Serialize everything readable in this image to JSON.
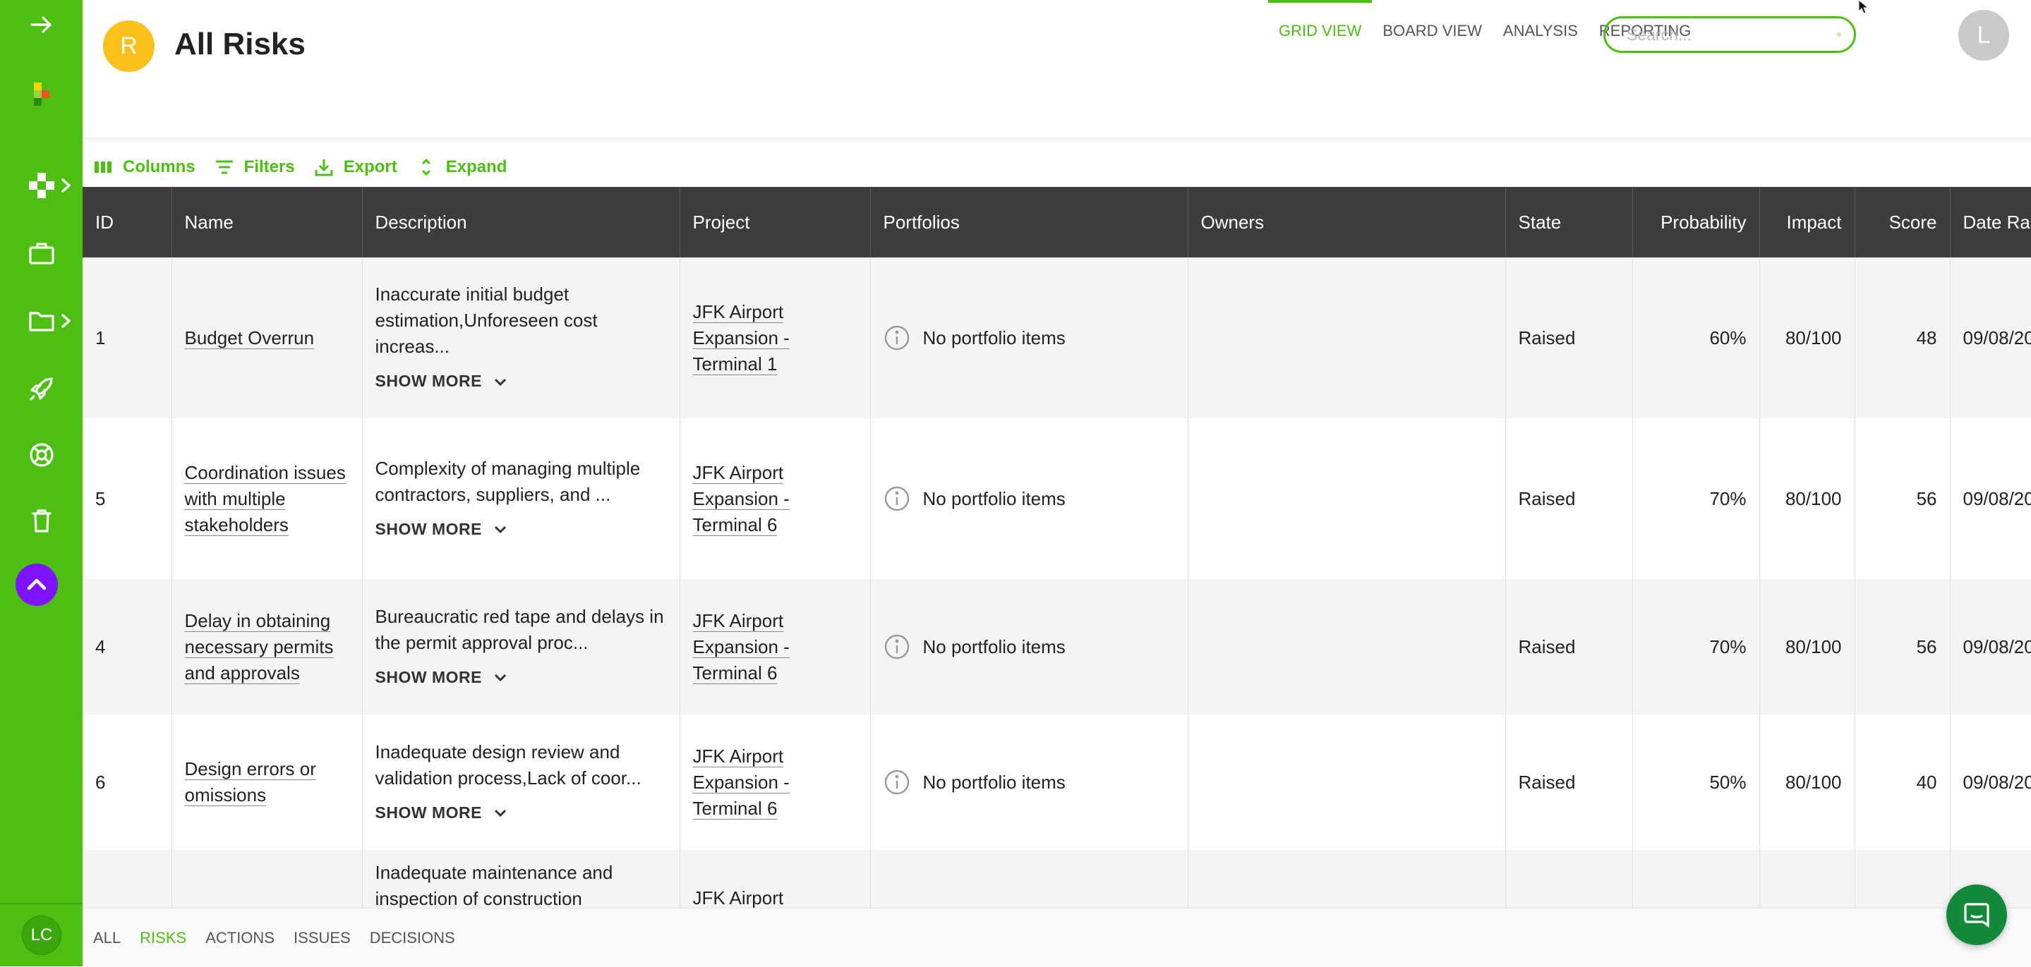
{
  "sidebar": {
    "user_initials": "LC",
    "icons": [
      "arrow-right-icon",
      "app-logo",
      "risk-hub-icon",
      "briefcase-icon",
      "folder-icon",
      "rocket-icon",
      "lifebuoy-icon",
      "trash-icon",
      "chevron-up-icon"
    ]
  },
  "header": {
    "project_initial": "R",
    "title": "All Risks",
    "tabs": [
      {
        "label": "GRID VIEW",
        "active": true
      },
      {
        "label": "BOARD VIEW",
        "active": false
      },
      {
        "label": "ANALYSIS",
        "active": false
      },
      {
        "label": "REPORTING",
        "active": false
      }
    ],
    "search_placeholder": "Search...",
    "user_initial": "L"
  },
  "toolbar": {
    "columns_label": "Columns",
    "filters_label": "Filters",
    "export_label": "Export",
    "expand_label": "Expand"
  },
  "table": {
    "columns": [
      "ID",
      "Name",
      "Description",
      "Project",
      "Portfolios",
      "Owners",
      "State",
      "Probability",
      "Impact",
      "Score",
      "Date Rai"
    ],
    "show_more_label": "SHOW MORE",
    "rows": [
      {
        "id": "1",
        "name": "Budget Overrun",
        "description": "Inaccurate initial budget estimation,Unforeseen cost increas...",
        "project": "JFK Airport Expansion - Terminal 1",
        "portfolios": "No portfolio items",
        "owners": "",
        "state": "Raised",
        "probability": "60%",
        "impact": "80/100",
        "score": "48",
        "date": "09/08/20"
      },
      {
        "id": "5",
        "name": "Coordination issues with multiple stakeholders",
        "description": "Complexity of managing multiple contractors, suppliers, and ...",
        "project": "JFK Airport Expansion - Terminal 6",
        "portfolios": "No portfolio items",
        "owners": "",
        "state": "Raised",
        "probability": "70%",
        "impact": "80/100",
        "score": "56",
        "date": "09/08/20"
      },
      {
        "id": "4",
        "name": "Delay in obtaining necessary permits and approvals",
        "description": "Bureaucratic red tape and delays in the permit approval proc...",
        "project": "JFK Airport Expansion - Terminal 6",
        "portfolios": "No portfolio items",
        "owners": "",
        "state": "Raised",
        "probability": "70%",
        "impact": "80/100",
        "score": "56",
        "date": "09/08/20"
      },
      {
        "id": "6",
        "name": "Design errors or omissions",
        "description": "Inadequate design review and validation process,Lack of coor...",
        "project": "JFK Airport Expansion - Terminal 6",
        "portfolios": "No portfolio items",
        "owners": "",
        "state": "Raised",
        "probability": "50%",
        "impact": "80/100",
        "score": "40",
        "date": "09/08/20"
      },
      {
        "id": "",
        "name": "",
        "description": "Inadequate maintenance and inspection of construction",
        "project": "JFK Airport",
        "portfolios": "",
        "owners": "",
        "state": "",
        "probability": "",
        "impact": "",
        "score": "",
        "date": ""
      }
    ]
  },
  "bottom_tabs": [
    {
      "label": "ALL",
      "active": false
    },
    {
      "label": "RISKS",
      "active": true
    },
    {
      "label": "ACTIONS",
      "active": false
    },
    {
      "label": "ISSUES",
      "active": false
    },
    {
      "label": "DECISIONS",
      "active": false
    }
  ],
  "colors": {
    "brand_green": "#4cbf12",
    "header_dark": "#3c3c3c",
    "accent_purple": "#7e14ff",
    "project_yellow": "#fbc01a",
    "chat_green": "#118a3a"
  }
}
